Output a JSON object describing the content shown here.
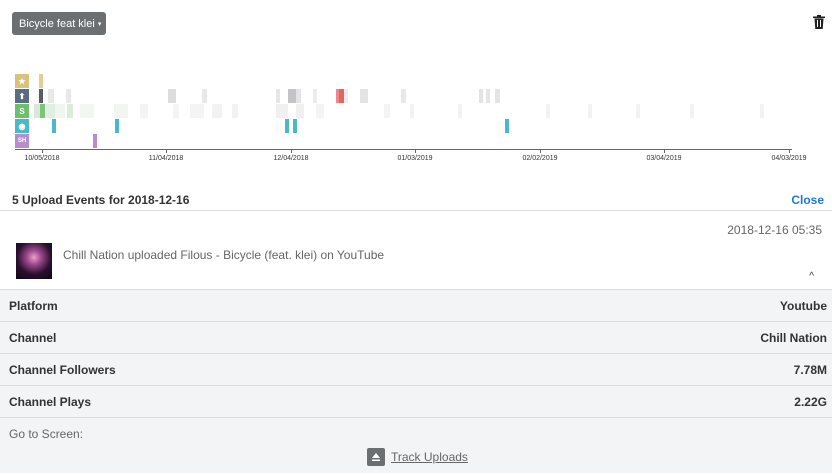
{
  "dropdown": {
    "label": "Bicycle feat klei",
    "caret": "▾"
  },
  "timeline": {
    "rows": [
      {
        "name": "star",
        "label": "★",
        "color": "#d9c27a"
      },
      {
        "name": "upload",
        "label": "⬆",
        "color": "#5b6b80"
      },
      {
        "name": "shazam",
        "label": "S",
        "color": "#6cc06c"
      },
      {
        "name": "views",
        "label": "◉",
        "color": "#4bb8c8"
      },
      {
        "name": "sh",
        "label": "SH",
        "color": "#b48fd0"
      }
    ],
    "ticks": [
      "10/05/2018",
      "11/04/2018",
      "12/04/2018",
      "01/03/2019",
      "02/02/2019",
      "03/04/2019",
      "04/03/2019"
    ]
  },
  "events": {
    "title": "5 Upload Events for 2018-12-16",
    "close_label": "Close",
    "item": {
      "time": "2018-12-16 05:35",
      "text": "Chill Nation uploaded Filous - Bicycle (feat. klei) on YouTube",
      "chevron": "^"
    }
  },
  "details": {
    "rows": [
      {
        "key": "Platform",
        "value": "Youtube"
      },
      {
        "key": "Channel",
        "value": "Chill Nation"
      },
      {
        "key": "Channel Followers",
        "value": "7.78M"
      },
      {
        "key": "Channel Plays",
        "value": "2.22G"
      }
    ],
    "goto_label": "Go to Screen:",
    "track_uploads_label": "Track Uploads"
  }
}
